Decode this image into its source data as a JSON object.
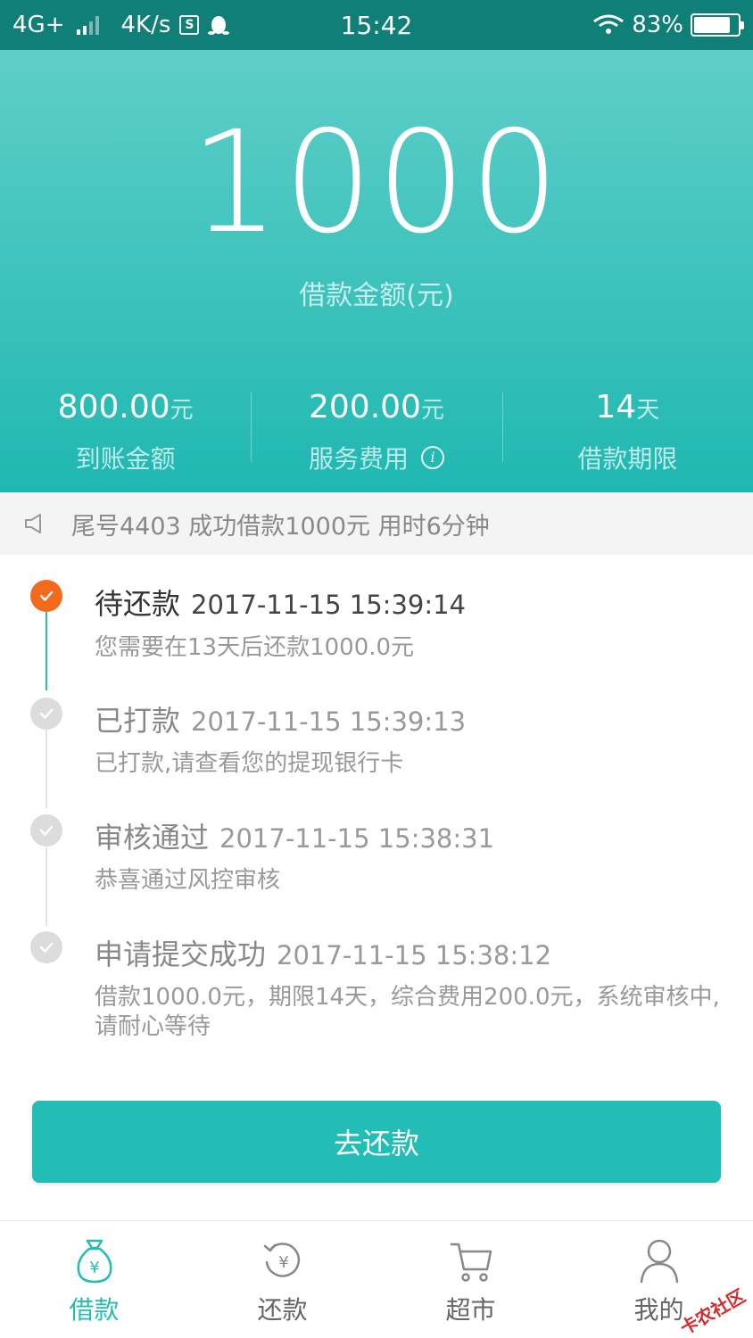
{
  "status_bar": {
    "network": "4G+",
    "speed": "4K/s",
    "s_icon": "S",
    "time": "15:42",
    "battery": "83%"
  },
  "hero": {
    "amount": "1000",
    "amount_label": "借款金额(元)",
    "stats": [
      {
        "value": "800.00",
        "unit": "元",
        "label": "到账金额"
      },
      {
        "value": "200.00",
        "unit": "元",
        "label": "服务费用"
      },
      {
        "value": "14",
        "unit": "天",
        "label": "借款期限"
      }
    ]
  },
  "notice": {
    "text": "尾号4403 成功借款1000元 用时6分钟"
  },
  "timeline": [
    {
      "title": "待还款",
      "time": "2017-11-15 15:39:14",
      "desc": "您需要在13天后还款1000.0元",
      "active": true
    },
    {
      "title": "已打款",
      "time": "2017-11-15 15:39:13",
      "desc": "已打款,请查看您的提现银行卡",
      "active": false
    },
    {
      "title": "审核通过",
      "time": "2017-11-15 15:38:31",
      "desc": "恭喜通过风控审核",
      "active": false
    },
    {
      "title": "申请提交成功",
      "time": "2017-11-15 15:38:12",
      "desc": "借款1000.0元，期限14天，综合费用200.0元，系统审核中,请耐心等待",
      "active": false
    }
  ],
  "repay_button": {
    "label": "去还款"
  },
  "tabs": [
    {
      "label": "借款",
      "icon": "money-bag-icon",
      "active": true
    },
    {
      "label": "还款",
      "icon": "repay-icon",
      "active": false
    },
    {
      "label": "超市",
      "icon": "cart-icon",
      "active": false
    },
    {
      "label": "我的",
      "icon": "user-icon",
      "active": false
    }
  ],
  "watermark": "卡农社区",
  "colors": {
    "status_bar": "#0f7f78",
    "accent": "#22bdb5",
    "active_dot": "#f26b1d"
  }
}
